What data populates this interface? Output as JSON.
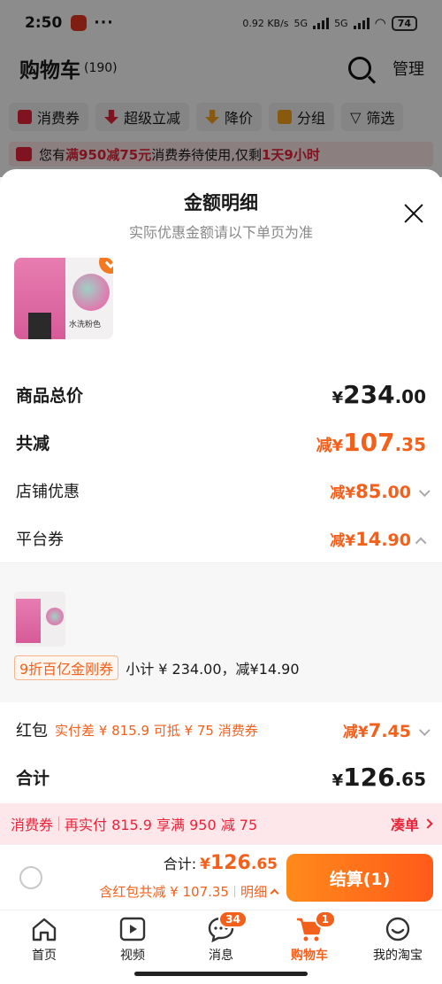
{
  "status": {
    "time": "2:50",
    "more": "···",
    "speed": "0.92 KB/s",
    "net1": "5G",
    "net2": "5G",
    "battery": "74"
  },
  "cart": {
    "title": "购物车",
    "count": "(190)",
    "manage": "管理"
  },
  "filters": [
    "消费券",
    "超级立减",
    "降价",
    "分组",
    "筛选"
  ],
  "banner": {
    "a": "您有",
    "b": "满950减75元",
    "c": "消费券待使用,仅剩",
    "d": "1天9小时"
  },
  "sheet": {
    "title": "金额明细",
    "subtitle": "实际优惠金额请以下单页为准",
    "swatch_label": "水洗粉色",
    "rows": {
      "total": {
        "label": "商品总价",
        "pre": "¥",
        "int": "234",
        "dec": ".00"
      },
      "reduce": {
        "label": "共减",
        "pre": "减¥",
        "int": "107",
        "dec": ".35"
      },
      "shop": {
        "label": "店铺优惠",
        "pre": "减¥",
        "int": "85",
        "dec": ".00"
      },
      "platform": {
        "label": "平台券",
        "pre": "减¥",
        "int": "14",
        "dec": ".90"
      }
    },
    "coupon": {
      "tag": "9折百亿金刚券",
      "text": "小计 ¥ 234.00，减¥14.90"
    },
    "hongbao": {
      "label": "红包",
      "note": "实付差 ¥ 815.9 可抵 ¥ 75 消费券",
      "pre": "减¥",
      "int": "7",
      "dec": ".45"
    },
    "sum": {
      "label": "合计",
      "pre": "¥",
      "int": "126",
      "dec": ".65"
    }
  },
  "promo": {
    "left": "消费券",
    "middle": "再实付 815.9 享满 950 减 75",
    "right": "凑单"
  },
  "checkout": {
    "total_label": "合计:",
    "pre": "¥",
    "int": "126",
    "dec": ".65",
    "sub": "含红包共减 ¥ 107.35",
    "detail": "明细",
    "button": "结算(1)"
  },
  "tabs": [
    {
      "label": "首页"
    },
    {
      "label": "视频"
    },
    {
      "label": "消息",
      "badge": "34"
    },
    {
      "label": "购物车",
      "badge": "1"
    },
    {
      "label": "我的淘宝"
    }
  ],
  "colors": {
    "accent": "#f2601c",
    "red": "#e8243a"
  }
}
